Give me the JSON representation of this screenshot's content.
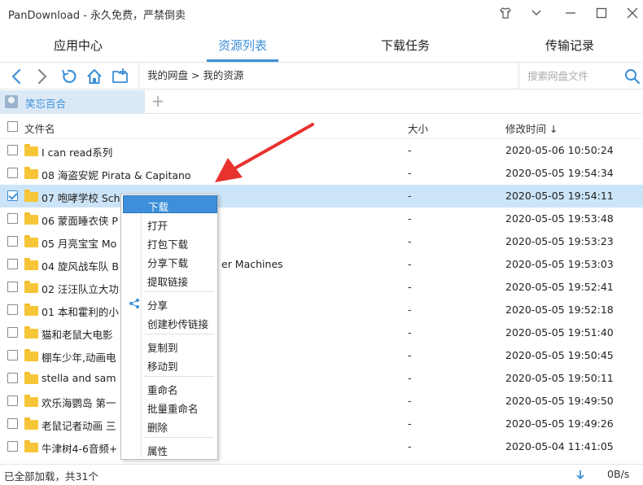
{
  "window": {
    "title": "PanDownload - 永久免费，严禁倒卖",
    "controls": [
      "shirt-icon",
      "chevron-down-icon",
      "minimize-icon",
      "maximize-icon",
      "close-icon"
    ]
  },
  "tabs": [
    {
      "label": "应用中心",
      "active": false
    },
    {
      "label": "资源列表",
      "active": true
    },
    {
      "label": "下载任务",
      "active": false
    },
    {
      "label": "传输记录",
      "active": false
    }
  ],
  "toolbar": {
    "breadcrumb": "我的网盘 > 我的资源",
    "search_placeholder": "搜索网盘文件"
  },
  "account": {
    "name": "笑忘百合"
  },
  "columns": {
    "name": "文件名",
    "size": "大小",
    "modified": "修改时间 ↓"
  },
  "files": [
    {
      "name": "I can read系列",
      "size": "-",
      "modified": "2020-05-06 10:50:24",
      "checked": false
    },
    {
      "name": "08 海盗安妮 Pirata & Capitano",
      "size": "-",
      "modified": "2020-05-05 19:54:34",
      "checked": false
    },
    {
      "name": "07 咆哮学校 Scho",
      "size": "-",
      "modified": "2020-05-05 19:54:11",
      "checked": true
    },
    {
      "name": "06 蒙面睡衣侠 P",
      "size": "-",
      "modified": "2020-05-05 19:53:48",
      "checked": false
    },
    {
      "name": "05 月亮宝宝 Mo",
      "size": "-",
      "modified": "2020-05-05 19:53:23",
      "checked": false
    },
    {
      "name": "04 旋风战车队 B",
      "name_tail": "er Machines",
      "size": "-",
      "modified": "2020-05-05 19:53:03",
      "checked": false
    },
    {
      "name": "02 汪汪队立大功",
      "size": "-",
      "modified": "2020-05-05 19:52:41",
      "checked": false
    },
    {
      "name": "01 本和霍利的小",
      "size": "-",
      "modified": "2020-05-05 19:52:18",
      "checked": false
    },
    {
      "name": "猫和老鼠大电影",
      "size": "-",
      "modified": "2020-05-05 19:51:40",
      "checked": false
    },
    {
      "name": "棚车少年,动画电",
      "size": "-",
      "modified": "2020-05-05 19:50:45",
      "checked": false
    },
    {
      "name": "stella and sam",
      "size": "-",
      "modified": "2020-05-05 19:50:11",
      "checked": false
    },
    {
      "name": "欢乐海鹦岛 第一",
      "size": "-",
      "modified": "2020-05-05 19:49:50",
      "checked": false
    },
    {
      "name": "老鼠记者动画 三",
      "size": "-",
      "modified": "2020-05-05 19:49:26",
      "checked": false
    },
    {
      "name": "牛津树4-6音频+",
      "size": "-",
      "modified": "2020-05-04 11:41:05",
      "checked": false
    }
  ],
  "context_menu": {
    "items": [
      "下载",
      "打开",
      "打包下载",
      "分享下载",
      "提取链接",
      "分享",
      "创建秒传链接",
      "复制到",
      "移动到",
      "重命名",
      "批量重命名",
      "删除",
      "属性"
    ],
    "highlighted": "下载",
    "share_icon": "share-icon"
  },
  "status": {
    "message": "已全部加载，共31个",
    "speed": "0B/s",
    "download_icon": "download-arrow-icon"
  },
  "colors": {
    "accent": "#3c8fd8",
    "selected_row": "#cce4f7",
    "annotation_arrow": "#e8322e",
    "folder": "#f7c638"
  }
}
